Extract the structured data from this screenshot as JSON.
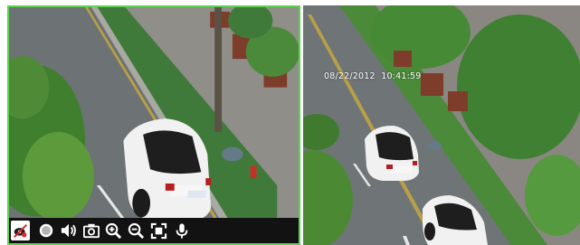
{
  "panes": [
    {
      "name": "camera-view-1",
      "selected": true,
      "timestamp": ""
    },
    {
      "name": "camera-view-2",
      "selected": false,
      "timestamp": "08/22/2012  10:41:59"
    }
  ],
  "toolbar": {
    "buttons": [
      {
        "icon": "close-video-icon"
      },
      {
        "icon": "record-icon"
      },
      {
        "icon": "volume-icon"
      },
      {
        "icon": "snapshot-icon"
      },
      {
        "icon": "zoom-in-icon"
      },
      {
        "icon": "zoom-out-icon"
      },
      {
        "icon": "fullscreen-icon"
      },
      {
        "icon": "microphone-icon"
      }
    ]
  },
  "colors": {
    "selected_border": "#5cd24f",
    "toolbar_bg": "#121212"
  }
}
